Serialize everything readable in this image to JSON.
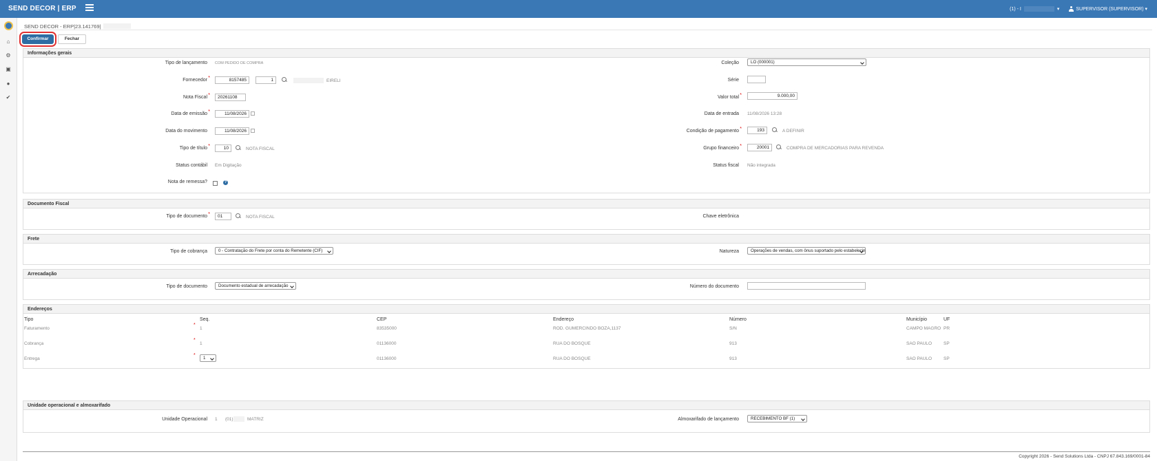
{
  "topbar": {
    "brand": "SEND DECOR | ERP",
    "company_prefix": "(1) - I",
    "user": "SUPERVISOR (SUPERVISOR)"
  },
  "header": {
    "doc_title": "SEND DECOR - ERP|23.141769|",
    "confirm_label": "Confirmar",
    "close_label": "Fechar"
  },
  "general": {
    "title": "Informações gerais",
    "tipo_lancamento_label": "Tipo de lançamento",
    "tipo_lancamento_value": "COM PEDIDO DE COMPRA",
    "fornecedor_label": "Fornecedor",
    "fornecedor_code": "8157485",
    "fornecedor_seq": "1",
    "fornecedor_name": "EIRELI",
    "nota_fiscal_label": "Nota Fiscal",
    "nota_fiscal_value": "20261108",
    "data_emissao_label": "Data de emissão",
    "data_emissao_value": "11/08/2026",
    "data_movimento_label": "Data do movimento",
    "data_movimento_value": "11/08/2026",
    "tipo_titulo_label": "Tipo de título",
    "tipo_titulo_code": "10",
    "tipo_titulo_desc": "NOTA FISCAL",
    "status_contabil_label": "Status contábil",
    "status_contabil_value": "Em Digitação",
    "nota_remessa_label": "Nota de remessa?",
    "colecao_label": "Coleção",
    "colecao_value": "LO        (000001)",
    "serie_label": "Série",
    "serie_value": "",
    "valor_total_label": "Valor total",
    "valor_total_value": "9.000,00",
    "data_entrada_label": "Data de entrada",
    "data_entrada_value": "11/08/2026 13:28",
    "condicao_pagamento_label": "Condição de pagamento",
    "condicao_pagamento_code": "193",
    "condicao_pagamento_desc": "A DEFINIR",
    "grupo_financeiro_label": "Grupo financeiro",
    "grupo_financeiro_code": "20001",
    "grupo_financeiro_desc": "COMPRA DE MERCADORIAS PARA REVENDA",
    "status_fiscal_label": "Status fiscal",
    "status_fiscal_value": "Não integrada"
  },
  "documento_fiscal": {
    "title": "Documento Fiscal",
    "tipo_documento_label": "Tipo de documento",
    "tipo_documento_code": "01",
    "tipo_documento_desc": "NOTA FISCAL",
    "chave_label": "Chave eletrônica"
  },
  "frete": {
    "title": "Frete",
    "tipo_cobranca_label": "Tipo de cobrança",
    "tipo_cobranca_value": "0 - Contratação do Frete por conta do Remetente (CIF)",
    "natureza_label": "Natureza",
    "natureza_value": "Operações de vendas, com ônus suportado pelo estabelecimento"
  },
  "arrecadacao": {
    "title": "Arrecadação",
    "tipo_documento_label": "Tipo de documento",
    "tipo_documento_value": "Documento estadual de arrecadação",
    "numero_documento_label": "Número do documento",
    "numero_documento_value": ""
  },
  "enderecos": {
    "title": "Endereços",
    "columns": [
      "Tipo",
      "Seq.",
      "CEP",
      "Endereço",
      "Número",
      "Município",
      "UF"
    ],
    "rows": [
      {
        "tipo": "Faturamento",
        "seq": "1",
        "cep": "83535000",
        "endereco": "ROD. GUMERCINDO BOZA,1137",
        "numero": "S/N",
        "municipio": "CAMPO MAGRO",
        "uf": "PR"
      },
      {
        "tipo": "Cobrança",
        "seq": "1",
        "cep": "01136000",
        "endereco": "RUA DO BOSQUE",
        "numero": "913",
        "municipio": "SAO PAULO",
        "uf": "SP"
      },
      {
        "tipo": "Entrega",
        "seq": "1",
        "cep": "01136000",
        "endereco": "RUA DO BOSQUE",
        "numero": "913",
        "municipio": "SAO PAULO",
        "uf": "SP"
      }
    ]
  },
  "unidade": {
    "title": "Unidade operacional e almoxarifado",
    "unidade_label": "Unidade Operacional",
    "unidade_code": "1",
    "unidade_sub": "(01)",
    "unidade_name": "MATRIZ",
    "almox_label": "Almoxarifado de lançamento",
    "almox_value": "RECEBIMENTO BF (1)"
  },
  "footer": {
    "copyright": "Copyright 2026 - Send Solutions Ltda - CNPJ 67.843.169/0001-84"
  }
}
